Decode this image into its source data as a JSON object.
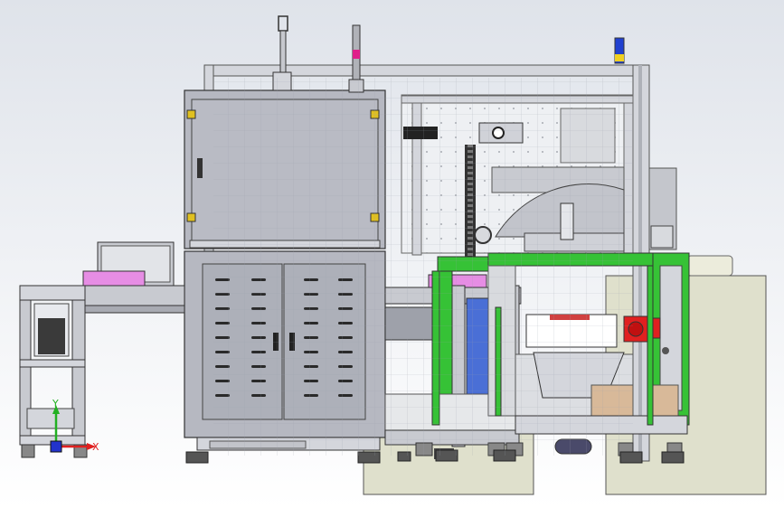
{
  "triad": {
    "y_label": "Y",
    "x_label": "X"
  },
  "colors": {
    "background_top": "#dfe3ea",
    "background_bottom": "#ffffff",
    "frame": "#d4d6dc",
    "cabinet": "#b6b8c1",
    "green": "#36c236",
    "pink": "#e68de4",
    "red": "#e02020",
    "floor": "#dfe0cc",
    "axis_x": "#e02020",
    "axis_y": "#22b022",
    "axis_z": "#2233cc"
  }
}
